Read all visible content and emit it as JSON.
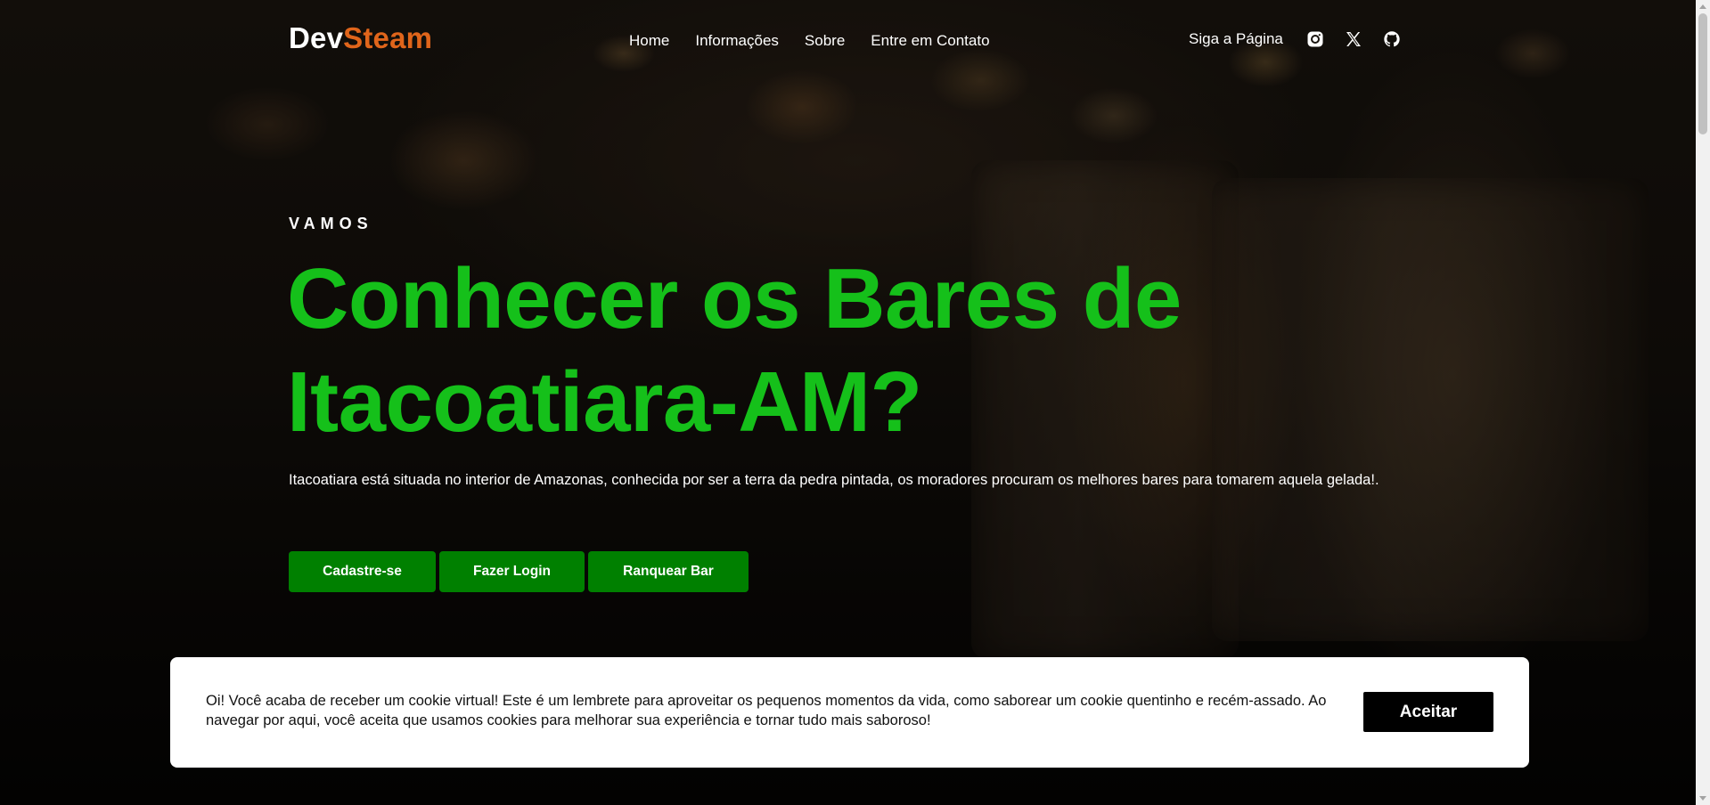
{
  "header": {
    "logo_part1": "Dev",
    "logo_part2": "Steam",
    "nav": [
      "Home",
      "Informações",
      "Sobre",
      "Entre em Contato"
    ],
    "follow_label": "Siga a Página",
    "social_icons": [
      "instagram-icon",
      "x-twitter-icon",
      "github-icon"
    ]
  },
  "hero": {
    "eyebrow": "VAMOS",
    "title": "Conhecer os Bares de Itacoatiara-AM?",
    "description": "Itacoatiara está situada no interior de Amazonas, conhecida por ser a terra da pedra pintada, os moradores procuram os melhores bares para tomarem aquela gelada!.",
    "buttons": [
      "Cadastre-se",
      "Fazer Login",
      "Ranquear Bar"
    ]
  },
  "cookie": {
    "text": "Oi! Você acaba de receber um cookie virtual! Este é um lembrete para aproveitar os pequenos momentos da vida, como saborear um cookie quentinho e recém-assado. Ao navegar por aqui, você aceita que usamos cookies para melhorar sua experiência e tornar tudo mais saboroso!",
    "accept_label": "Aceitar"
  },
  "colors": {
    "brand_accent": "#e0651b",
    "title_green": "#15c01a",
    "button_green": "#008000",
    "cookie_button": "#000000"
  }
}
